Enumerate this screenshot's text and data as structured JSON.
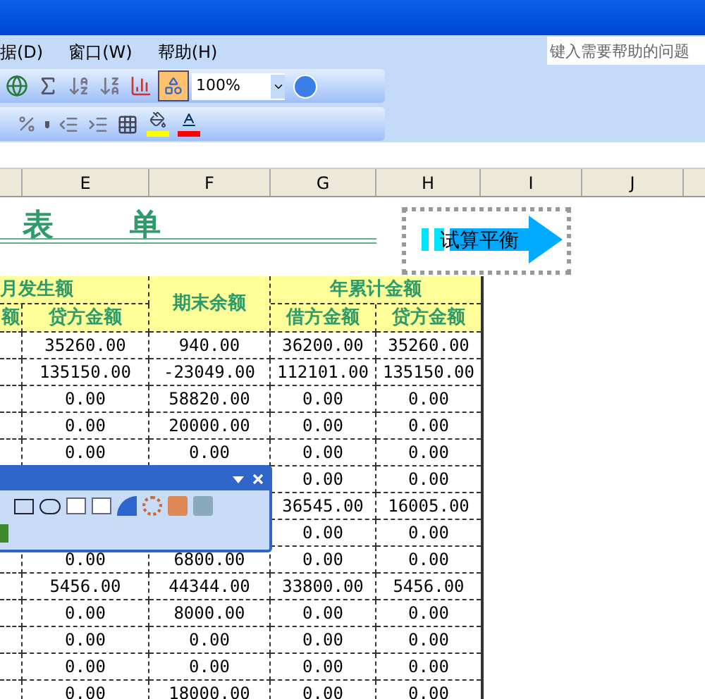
{
  "menu": [
    {
      "label": "据(D)"
    },
    {
      "label": "窗口(W)"
    },
    {
      "label": "帮助(H)"
    }
  ],
  "help_box": {
    "placeholder": "键入需要帮助的问题"
  },
  "toolbar": {
    "zoom": "100%"
  },
  "columns": [
    "E",
    "F",
    "G",
    "H",
    "I",
    "J"
  ],
  "title": [
    "表",
    "单"
  ],
  "shape": {
    "text": "试算平衡",
    "selected": true
  },
  "table": {
    "group_1": "月发生额",
    "column_balance": "期末余额",
    "group_2": "年累计金额",
    "subheaders": [
      "额",
      "贷方金额",
      "借方金额",
      "贷方金额"
    ],
    "rows": [
      [
        "35260.00",
        "940.00",
        "36200.00",
        "35260.00"
      ],
      [
        "135150.00",
        "-23049.00",
        "112101.00",
        "135150.00"
      ],
      [
        "0.00",
        "58820.00",
        "0.00",
        "0.00"
      ],
      [
        "0.00",
        "20000.00",
        "0.00",
        "0.00"
      ],
      [
        "0.00",
        "0.00",
        "0.00",
        "0.00"
      ],
      [
        null,
        null,
        "0.00",
        "0.00"
      ],
      [
        null,
        null,
        "36545.00",
        "16005.00"
      ],
      [
        null,
        null,
        "0.00",
        "0.00"
      ],
      [
        "0.00",
        "6800.00",
        "0.00",
        "0.00"
      ],
      [
        "5456.00",
        "44344.00",
        "33800.00",
        "5456.00"
      ],
      [
        "0.00",
        "8000.00",
        "0.00",
        "0.00"
      ],
      [
        "0.00",
        "0.00",
        "0.00",
        "0.00"
      ],
      [
        "0.00",
        "0.00",
        "0.00",
        "0.00"
      ],
      [
        "0.00",
        "18000.00",
        "0.00",
        "0.00"
      ]
    ]
  }
}
